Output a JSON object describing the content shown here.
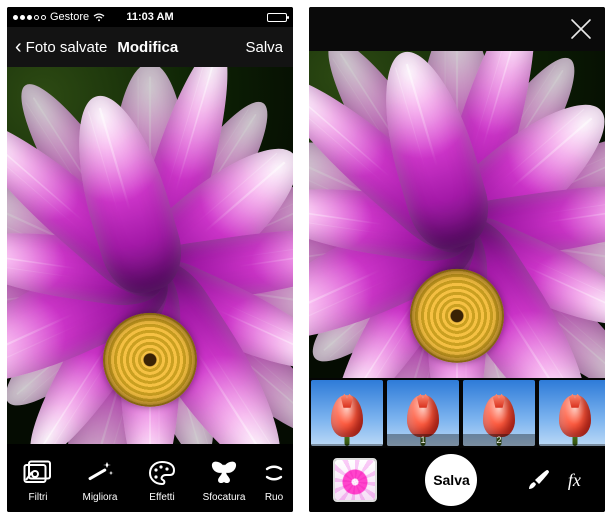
{
  "statusbar": {
    "carrier": "Gestore",
    "time": "11:03 AM"
  },
  "nav": {
    "back_label": "Foto salvate",
    "title": "Modifica",
    "action": "Salva"
  },
  "left_tools": [
    {
      "label": "Filtri"
    },
    {
      "label": "Migliora"
    },
    {
      "label": "Effetti"
    },
    {
      "label": "Sfocatura"
    },
    {
      "label": "Ruo"
    }
  ],
  "right": {
    "save_label": "Salva",
    "fx_label": "fx"
  },
  "filmstrip": [
    {
      "label": ""
    },
    {
      "label": "1"
    },
    {
      "label": "2"
    },
    {
      "label": ""
    }
  ]
}
